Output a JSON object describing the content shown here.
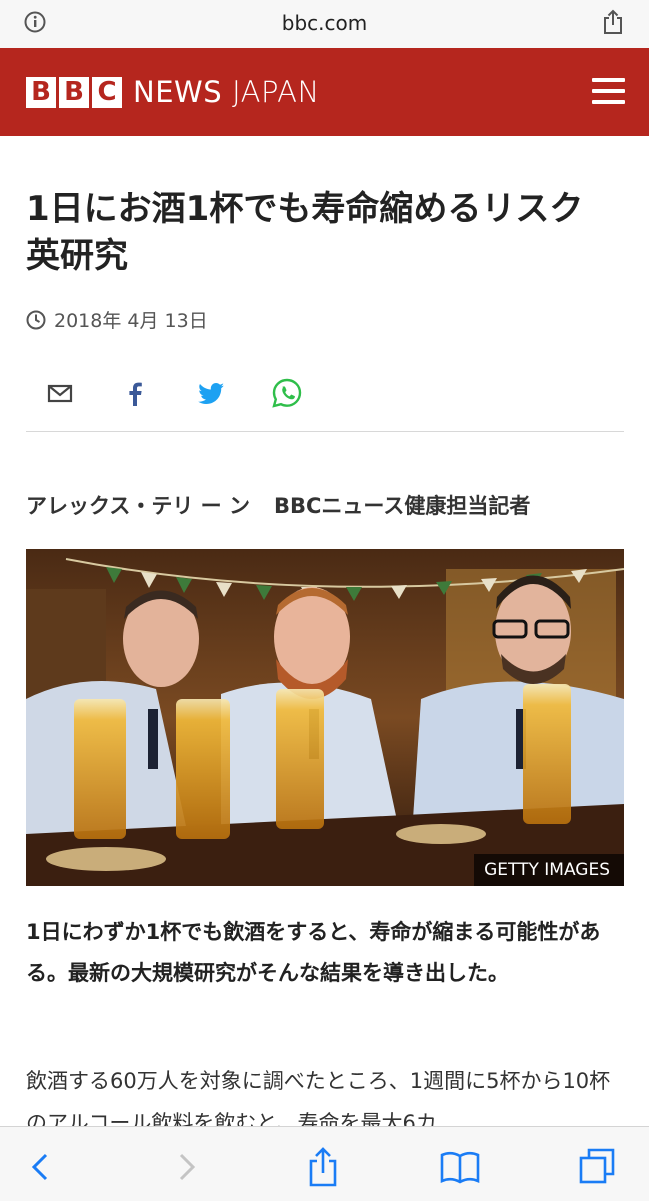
{
  "browser": {
    "domain": "bbc.com"
  },
  "header": {
    "logo_letters": [
      "B",
      "B",
      "C"
    ],
    "news": "NEWS",
    "edition": "JAPAN",
    "brand_color": "#b5261e"
  },
  "article": {
    "headline": "1日にお酒1杯でも寿命縮めるリスク　英研究",
    "date": "2018年 4月 13日",
    "share_icons": [
      "email-icon",
      "facebook-icon",
      "twitter-icon",
      "whatsapp-icon"
    ],
    "byline_author": "アレックス・テリ ー ン",
    "byline_role": "BBCニュース健康担当記者",
    "image_credit": "GETTY IMAGES",
    "lead": "1日にわずか1杯でも飲酒をすると、寿命が縮まる可能性がある。最新の大規模研究がそんな結果を導き出した。",
    "body": "飲酒する60万人を対象に調べたところ、1週間に5杯から10杯のアルコール飲料を飲むと、寿命を最大6カ"
  },
  "toolbar": {
    "icons": [
      "back-icon",
      "forward-icon",
      "share-icon",
      "bookmarks-icon",
      "tabs-icon"
    ]
  }
}
